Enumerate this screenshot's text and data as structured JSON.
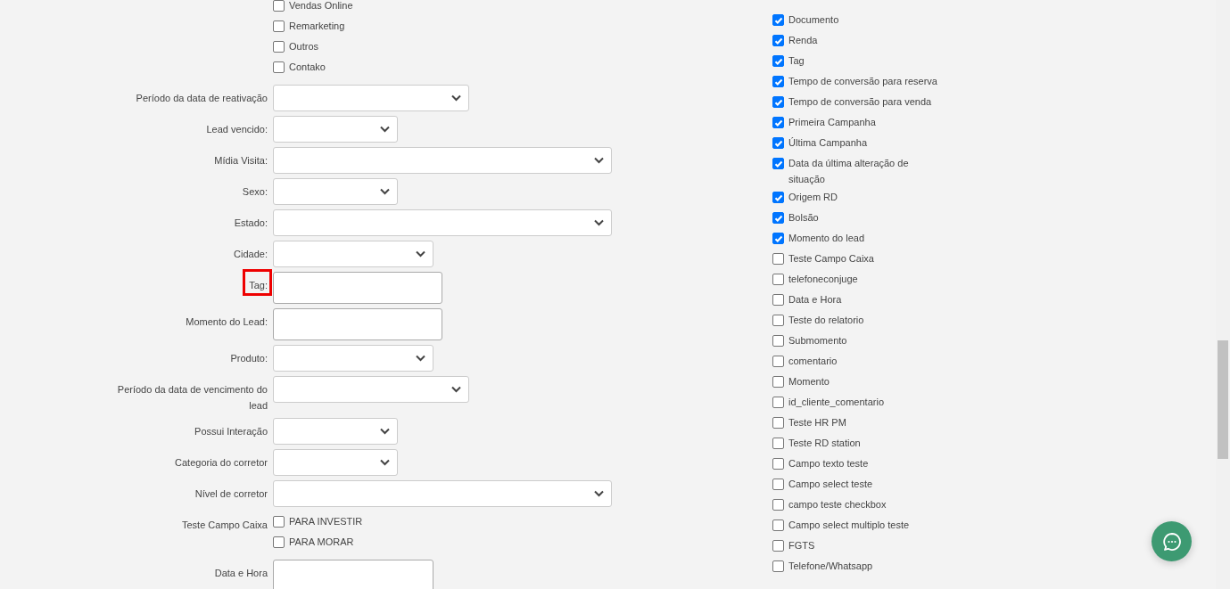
{
  "filter_form": {
    "fields": [
      {
        "kind": "checkboxes",
        "options": [
          {
            "label": "Vendas Online",
            "checked": false
          },
          {
            "label": "Remarketing",
            "checked": false
          },
          {
            "label": "Outros",
            "checked": false
          },
          {
            "label": "Contako",
            "checked": false
          }
        ]
      },
      {
        "kind": "select",
        "label": "Período da data de reativação"
      },
      {
        "kind": "select",
        "label": "Lead vencido:"
      },
      {
        "kind": "select",
        "label": "Mídia Visita:"
      },
      {
        "kind": "select",
        "label": "Sexo:"
      },
      {
        "kind": "select",
        "label": "Estado:"
      },
      {
        "kind": "select",
        "label": "Cidade:"
      },
      {
        "kind": "text",
        "label": "Tag:",
        "highlighted": true
      },
      {
        "kind": "text",
        "label": "Momento do Lead:"
      },
      {
        "kind": "select",
        "label": "Produto:"
      },
      {
        "kind": "select",
        "label": "Período da data de vencimento do lead"
      },
      {
        "kind": "select",
        "label": "Possui Interação"
      },
      {
        "kind": "select",
        "label": "Categoria do corretor"
      },
      {
        "kind": "select",
        "label": "Nível de corretor"
      },
      {
        "kind": "checkboxes",
        "label": "Teste Campo Caixa",
        "options": [
          {
            "label": "PARA INVESTIR",
            "checked": false
          },
          {
            "label": "PARA MORAR",
            "checked": false
          }
        ]
      },
      {
        "kind": "text",
        "label": "Data e Hora"
      }
    ]
  },
  "columns": [
    {
      "label": "Documento",
      "checked": true
    },
    {
      "label": "Renda",
      "checked": true
    },
    {
      "label": "Tag",
      "checked": true
    },
    {
      "label": "Tempo de conversão para reserva",
      "checked": true
    },
    {
      "label": "Tempo de conversão para venda",
      "checked": true
    },
    {
      "label": "Primeira Campanha",
      "checked": true
    },
    {
      "label": "Última Campanha",
      "checked": true
    },
    {
      "label": "Data da última alteração de situação",
      "checked": true
    },
    {
      "label": "Origem RD",
      "checked": true
    },
    {
      "label": "Bolsão",
      "checked": true
    },
    {
      "label": "Momento do lead",
      "checked": true
    },
    {
      "label": "Teste Campo Caixa",
      "checked": false
    },
    {
      "label": "telefoneconjuge",
      "checked": false
    },
    {
      "label": "Data e Hora",
      "checked": false
    },
    {
      "label": "Teste do relatorio",
      "checked": false
    },
    {
      "label": "Submomento",
      "checked": false
    },
    {
      "label": "comentario",
      "checked": false
    },
    {
      "label": "Momento",
      "checked": false
    },
    {
      "label": "id_cliente_comentario",
      "checked": false
    },
    {
      "label": "Teste HR PM",
      "checked": false
    },
    {
      "label": "Teste RD station",
      "checked": false
    },
    {
      "label": "Campo texto teste",
      "checked": false
    },
    {
      "label": "Campo select teste",
      "checked": false
    },
    {
      "label": "campo teste checkbox",
      "checked": false
    },
    {
      "label": "Campo select multiplo teste",
      "checked": false
    },
    {
      "label": "FGTS",
      "checked": false
    },
    {
      "label": "Telefone/Whatsapp",
      "checked": false
    }
  ]
}
